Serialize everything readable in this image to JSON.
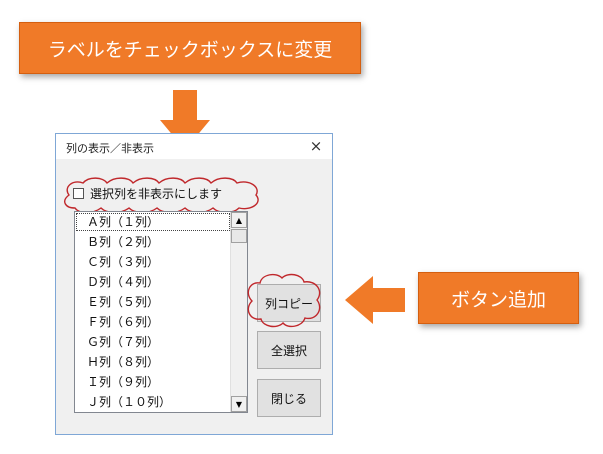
{
  "colors": {
    "callout_fill": "#f07a28",
    "arrow_fill": "#f07a28",
    "cloud_stroke": "#c0282c",
    "dialog_border": "#7fa7d6"
  },
  "annotations": {
    "top_callout": "ラベルをチェックボックスに変更",
    "right_callout": "ボタン追加"
  },
  "dialog": {
    "title": "列の表示／非表示",
    "close_icon": "×",
    "checkbox": {
      "label": "選択列を非表示にします",
      "checked": false
    },
    "list": {
      "items": [
        "Ａ列（１列）",
        "Ｂ列（２列）",
        "Ｃ列（３列）",
        "Ｄ列（４列）",
        "Ｅ列（５列）",
        "Ｆ列（６列）",
        "Ｇ列（７列）",
        "Ｈ列（８列）",
        "Ｉ列（９列）",
        "Ｊ列（１０列）"
      ],
      "scroll_up_icon": "▲",
      "scroll_down_icon": "▼"
    },
    "buttons": {
      "copy_columns": "列コピー",
      "select_all": "全選択",
      "close": "閉じる"
    }
  }
}
